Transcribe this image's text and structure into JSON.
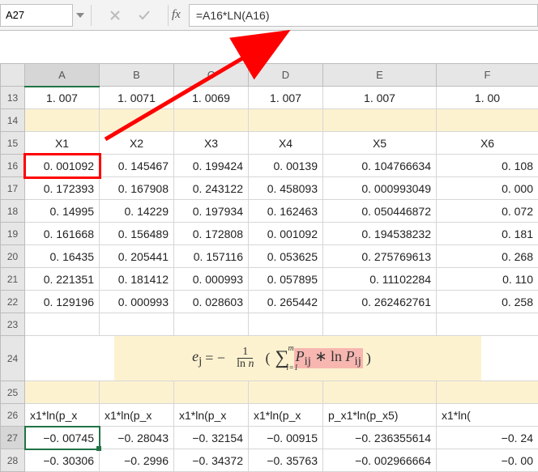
{
  "formula_bar": {
    "name_box": "A27",
    "fx_label": "fx",
    "formula": "=A16*LN(A16)"
  },
  "columns": [
    "A",
    "B",
    "C",
    "D",
    "E",
    "F"
  ],
  "rows_visible": [
    "13",
    "14",
    "15",
    "16",
    "17",
    "18",
    "19",
    "20",
    "21",
    "22",
    "23",
    "24",
    "25",
    "26",
    "27",
    "28"
  ],
  "r13": {
    "A": "1. 007",
    "B": "1. 0071",
    "C": "1. 0069",
    "D": "1. 007",
    "E": "1. 007",
    "F": "1. 00"
  },
  "r15": {
    "A": "X1",
    "B": "X2",
    "C": "X3",
    "D": "X4",
    "E": "X5",
    "F": "X6"
  },
  "r16": {
    "A": "0. 001092",
    "B": "0. 145467",
    "C": "0. 199424",
    "D": "0. 00139",
    "E": "0. 104766634",
    "F": "0. 108"
  },
  "r17": {
    "A": "0. 172393",
    "B": "0. 167908",
    "C": "0. 243122",
    "D": "0. 458093",
    "E": "0. 000993049",
    "F": "0. 000"
  },
  "r18": {
    "A": "0. 14995",
    "B": "0. 14229",
    "C": "0. 197934",
    "D": "0. 162463",
    "E": "0. 050446872",
    "F": "0. 072"
  },
  "r19": {
    "A": "0. 161668",
    "B": "0. 156489",
    "C": "0. 172808",
    "D": "0. 001092",
    "E": "0. 194538232",
    "F": "0. 181"
  },
  "r20": {
    "A": "0. 16435",
    "B": "0. 205441",
    "C": "0. 157116",
    "D": "0. 053625",
    "E": "0. 275769613",
    "F": "0. 268"
  },
  "r21": {
    "A": "0. 221351",
    "B": "0. 181412",
    "C": "0. 000993",
    "D": "0. 057895",
    "E": "0. 11102284",
    "F": "0. 110"
  },
  "r22": {
    "A": "0. 129196",
    "B": "0. 000993",
    "C": "0. 028603",
    "D": "0. 265442",
    "E": "0. 262462761",
    "F": "0. 258"
  },
  "math": {
    "lhs": "e",
    "lhs_sub": "j",
    "eq": " = −",
    "frac_top": "1",
    "frac_bot_pre": "ln ",
    "frac_bot_var": "n",
    "open": "(",
    "sigma": "∑",
    "sigma_top": "m",
    "sigma_bot": "i=1",
    "term_p": "P",
    "term_sub": "ij",
    "star": " ∗ ln ",
    "close": ")"
  },
  "r26": {
    "A": "x1*ln(p_x",
    "B": "x1*ln(p_x",
    "C": "x1*ln(p_x",
    "D": "x1*ln(p_x",
    "E": "p_x1*ln(p_x5)",
    "F": "x1*ln("
  },
  "r27": {
    "A": "−0. 00745",
    "B": "−0. 28043",
    "C": "−0. 32154",
    "D": "−0. 00915",
    "E": "−0. 236355614",
    "F": "−0. 24"
  },
  "r28": {
    "A": "−0. 30306",
    "B": "−0. 2996",
    "C": "−0. 34372",
    "D": "−0. 35763",
    "E": "−0. 002966664",
    "F": "−0. 00"
  }
}
